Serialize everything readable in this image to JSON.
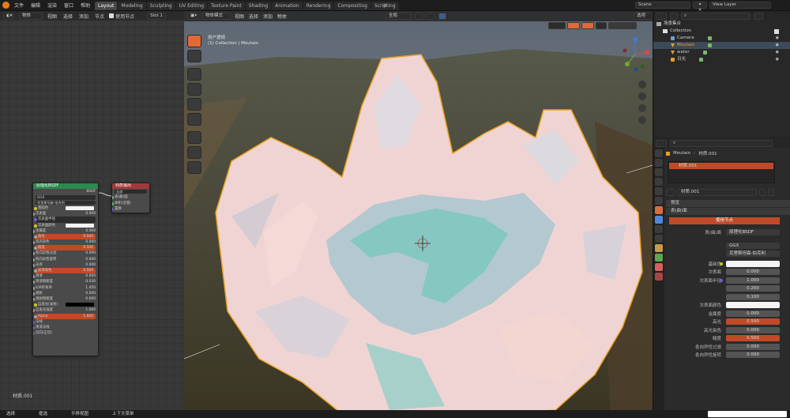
{
  "menubar": {
    "items": [
      "文件",
      "编辑",
      "渲染",
      "窗口",
      "帮助"
    ]
  },
  "tabs": [
    "Layout",
    "Modeling",
    "Sculpting",
    "UV Editing",
    "Texture Paint",
    "Shading",
    "Animation",
    "Rendering",
    "Compositing",
    "Scripting"
  ],
  "active_tab": "Layout",
  "scene": {
    "name": "Scene",
    "view_layer": "View Layer"
  },
  "node_editor": {
    "object_select": "物体",
    "menus": [
      "视图",
      "选择",
      "添加",
      "节点"
    ],
    "use_nodes": "使用节点",
    "slot": "Slot 1",
    "material_label": "材质.001",
    "bsdf": {
      "title": "原理化BSDF",
      "output": "BSDF",
      "dist": "GGX",
      "sss_method": "克里斯坦森-伯克利",
      "rows": [
        {
          "label": "基础色",
          "value": "",
          "type": "white",
          "sock": "#c7c729"
        },
        {
          "label": "次表面",
          "value": "0.000",
          "type": "num",
          "sock": "#a1a1a1"
        },
        {
          "label": "次表面半径",
          "value": "",
          "type": "bar",
          "sock": "#6363c7"
        },
        {
          "label": "次表面颜色",
          "value": "",
          "type": "white",
          "sock": "#c7c729"
        },
        {
          "label": "金属度",
          "value": "0.000",
          "type": "num",
          "sock": "#a1a1a1"
        },
        {
          "label": "高光",
          "value": "0.500",
          "type": "red",
          "sock": "#a1a1a1"
        },
        {
          "label": "高光染色",
          "value": "0.000",
          "type": "num",
          "sock": "#a1a1a1"
        },
        {
          "label": "糙度",
          "value": "0.500",
          "type": "red",
          "sock": "#a1a1a1"
        },
        {
          "label": "各向异性过滤",
          "value": "0.000",
          "type": "num",
          "sock": "#a1a1a1"
        },
        {
          "label": "各向异性旋转",
          "value": "0.000",
          "type": "num",
          "sock": "#a1a1a1"
        },
        {
          "label": "光泽",
          "value": "0.000",
          "type": "num",
          "sock": "#a1a1a1"
        },
        {
          "label": "光泽染色",
          "value": "0.500",
          "type": "red",
          "sock": "#a1a1a1"
        },
        {
          "label": "清漆",
          "value": "0.000",
          "type": "num",
          "sock": "#a1a1a1"
        },
        {
          "label": "清漆粗糙度",
          "value": "0.030",
          "type": "num",
          "sock": "#a1a1a1"
        },
        {
          "label": "IOR折射率",
          "value": "1.450",
          "type": "num",
          "sock": "#a1a1a1"
        },
        {
          "label": "透射",
          "value": "0.000",
          "type": "num",
          "sock": "#a1a1a1"
        },
        {
          "label": "透射粗糙度",
          "value": "0.000",
          "type": "num",
          "sock": "#a1a1a1"
        },
        {
          "label": "自发光(发射)",
          "value": "",
          "type": "black",
          "sock": "#c7c729"
        },
        {
          "label": "自发光强度",
          "value": "1.000",
          "type": "num",
          "sock": "#a1a1a1"
        },
        {
          "label": "Alpha",
          "value": "1.000",
          "type": "red",
          "sock": "#a1a1a1"
        },
        {
          "label": "法线",
          "value": "",
          "type": "none",
          "sock": "#6363c7"
        },
        {
          "label": "清漆法线",
          "value": "",
          "type": "none",
          "sock": "#6363c7"
        },
        {
          "label": "切向(正切)",
          "value": "",
          "type": "none",
          "sock": "#6363c7"
        }
      ]
    },
    "output": {
      "title": "材质输出",
      "target": "全部",
      "rows": [
        "表(曲)面",
        "体积(音量)",
        "置换"
      ]
    }
  },
  "viewport": {
    "mode": "物体模式",
    "menus": [
      "视图",
      "选择",
      "添加",
      "物体"
    ],
    "transform": "全局",
    "overlay_label": "选项",
    "view_name": "用户透视",
    "collection_info": "(1) Collection | Moutain"
  },
  "outliner": {
    "title": "场景集合",
    "collection": "Collection",
    "items": [
      {
        "name": "Camera",
        "icon": "camera-icon"
      },
      {
        "name": "Moutain",
        "icon": "mesh-icon",
        "selected": true
      },
      {
        "name": "water",
        "icon": "mesh-icon"
      },
      {
        "name": "日光",
        "icon": "light-icon"
      }
    ]
  },
  "properties": {
    "breadcrumb_object": "Moutain",
    "breadcrumb_material": "材质.001",
    "slot_item": "材质.001",
    "material_name": "材质.001",
    "sections": {
      "preview": "预览",
      "surface": "表(曲)面"
    },
    "use_nodes": "使用节点",
    "surface_label": "表(曲)面",
    "surface_value": "原理化BSDF",
    "distribution": "GGX",
    "sss": "克里斯坦森-伯克利",
    "rows": [
      {
        "label": "基础色",
        "value": "",
        "type": "white",
        "dot": "#c7c729"
      },
      {
        "label": "次表面",
        "value": "0.000",
        "type": "num",
        "dot": ""
      },
      {
        "label": "次表面半径",
        "value": "1.000",
        "type": "num",
        "dot": "#6363c7"
      },
      {
        "label": "",
        "value": "0.200",
        "type": "num",
        "dot": ""
      },
      {
        "label": "",
        "value": "0.100",
        "type": "num",
        "dot": ""
      },
      {
        "label": "次表面颜色",
        "value": "",
        "type": "white",
        "dot": ""
      },
      {
        "label": "金属度",
        "value": "0.000",
        "type": "num",
        "dot": ""
      },
      {
        "label": "高光",
        "value": "0.500",
        "type": "red",
        "dot": ""
      },
      {
        "label": "高光染色",
        "value": "0.000",
        "type": "num",
        "dot": ""
      },
      {
        "label": "糙度",
        "value": "0.500",
        "type": "red",
        "dot": ""
      },
      {
        "label": "各向异性过滤",
        "value": "0.000",
        "type": "num",
        "dot": ""
      },
      {
        "label": "各向异性旋转",
        "value": "0.000",
        "type": "num",
        "dot": ""
      }
    ]
  },
  "statusbar": {
    "items": [
      "选择",
      "框选",
      "平移视图",
      "上下文菜单"
    ]
  },
  "colors": {
    "accent": "#e06a37",
    "terrain_pink": "#f2cfcc",
    "water": "#7fc8c0",
    "selection": "#e8a020"
  }
}
